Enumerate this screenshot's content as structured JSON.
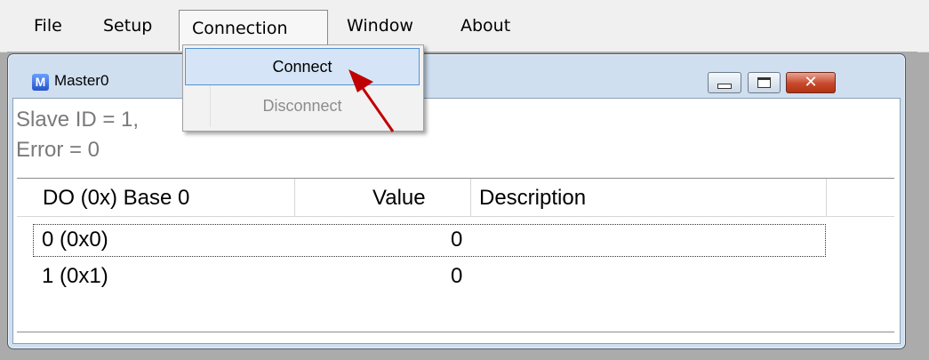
{
  "menubar": {
    "items": [
      {
        "label": "File"
      },
      {
        "label": "Setup"
      },
      {
        "label": "Connection"
      },
      {
        "label": "Window"
      },
      {
        "label": "About"
      }
    ]
  },
  "connection_menu": {
    "items": [
      {
        "label": "Connect",
        "state": "highlighted"
      },
      {
        "label": "Disconnect",
        "state": "disabled"
      }
    ]
  },
  "child_window": {
    "icon_letter": "M",
    "title": "Master0",
    "status": {
      "slave_line": "Slave ID = 1,",
      "error_line": "Error = 0"
    },
    "table": {
      "headers": [
        "DO (0x) Base 0",
        "Value",
        "Description"
      ],
      "rows": [
        {
          "address": "0 (0x0)",
          "value": "0",
          "description": ""
        },
        {
          "address": "1 (0x1)",
          "value": "0",
          "description": ""
        }
      ]
    }
  },
  "colors": {
    "highlight_bg": "#d5e5f7",
    "highlight_border": "#5592d6",
    "annotation_arrow": "#c00000",
    "close_button": "#c7482b"
  }
}
